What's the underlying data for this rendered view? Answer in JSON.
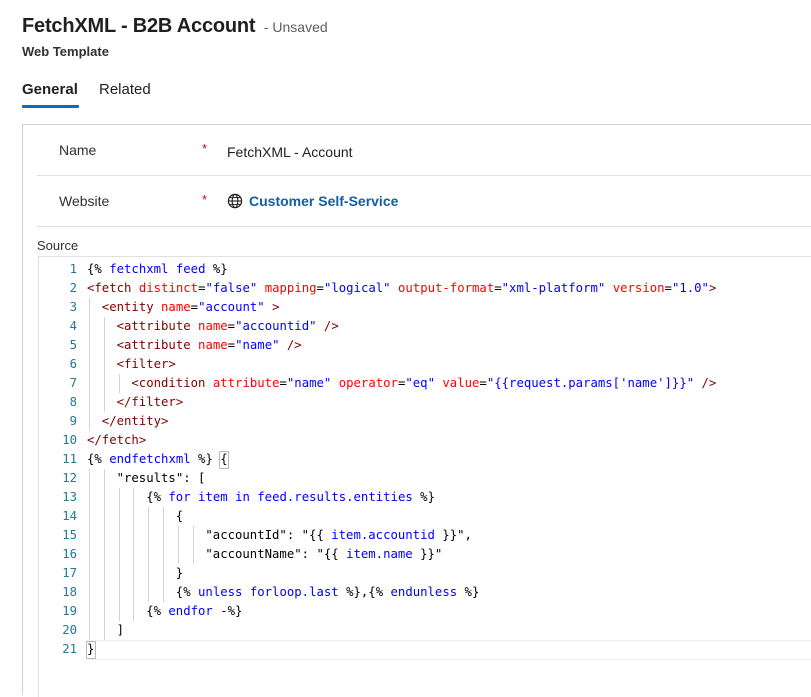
{
  "header": {
    "title": "FetchXML - B2B Account",
    "status": "- Unsaved",
    "entity_type": "Web Template"
  },
  "tabs": [
    {
      "label": "General",
      "selected": true
    },
    {
      "label": "Related",
      "selected": false
    }
  ],
  "fields": {
    "name": {
      "label": "Name",
      "required_mark": "*",
      "value": "FetchXML - Account"
    },
    "website": {
      "label": "Website",
      "required_mark": "*",
      "value": "Customer Self-Service",
      "icon": "globe-icon"
    }
  },
  "source": {
    "label": "Source",
    "lines": [
      {
        "n": "1",
        "indent": 0,
        "tokens": [
          [
            "t-plain",
            "{% "
          ],
          [
            "t-kw",
            "fetchxml"
          ],
          [
            "t-plain",
            " "
          ],
          [
            "t-kw",
            "feed"
          ],
          [
            "t-plain",
            " %}"
          ]
        ]
      },
      {
        "n": "2",
        "indent": 0,
        "tokens": [
          [
            "t-tag",
            "<fetch"
          ],
          [
            "t-plain",
            " "
          ],
          [
            "t-attr",
            "distinct"
          ],
          [
            "t-plain",
            "="
          ],
          [
            "t-val",
            "\"false\""
          ],
          [
            "t-plain",
            " "
          ],
          [
            "t-attr",
            "mapping"
          ],
          [
            "t-plain",
            "="
          ],
          [
            "t-val",
            "\"logical\""
          ],
          [
            "t-plain",
            " "
          ],
          [
            "t-attr",
            "output-format"
          ],
          [
            "t-plain",
            "="
          ],
          [
            "t-val",
            "\"xml-platform\""
          ],
          [
            "t-plain",
            " "
          ],
          [
            "t-attr",
            "version"
          ],
          [
            "t-plain",
            "="
          ],
          [
            "t-val",
            "\"1.0\""
          ],
          [
            "t-tag",
            ">"
          ]
        ]
      },
      {
        "n": "3",
        "indent": 2,
        "tokens": [
          [
            "t-tag",
            "<entity"
          ],
          [
            "t-plain",
            " "
          ],
          [
            "t-attr",
            "name"
          ],
          [
            "t-plain",
            "="
          ],
          [
            "t-val",
            "\"account\""
          ],
          [
            "t-plain",
            " "
          ],
          [
            "t-tag",
            ">"
          ]
        ]
      },
      {
        "n": "4",
        "indent": 4,
        "tokens": [
          [
            "t-tag",
            "<attribute"
          ],
          [
            "t-plain",
            " "
          ],
          [
            "t-attr",
            "name"
          ],
          [
            "t-plain",
            "="
          ],
          [
            "t-val",
            "\"accountid\""
          ],
          [
            "t-plain",
            " "
          ],
          [
            "t-tag",
            "/>"
          ]
        ]
      },
      {
        "n": "5",
        "indent": 4,
        "tokens": [
          [
            "t-tag",
            "<attribute"
          ],
          [
            "t-plain",
            " "
          ],
          [
            "t-attr",
            "name"
          ],
          [
            "t-plain",
            "="
          ],
          [
            "t-val",
            "\"name\""
          ],
          [
            "t-plain",
            " "
          ],
          [
            "t-tag",
            "/>"
          ]
        ]
      },
      {
        "n": "6",
        "indent": 4,
        "tokens": [
          [
            "t-tag",
            "<filter>"
          ]
        ]
      },
      {
        "n": "7",
        "indent": 6,
        "tokens": [
          [
            "t-tag",
            "<condition"
          ],
          [
            "t-plain",
            " "
          ],
          [
            "t-attr",
            "attribute"
          ],
          [
            "t-plain",
            "="
          ],
          [
            "t-val",
            "\"name\""
          ],
          [
            "t-plain",
            " "
          ],
          [
            "t-attr",
            "operator"
          ],
          [
            "t-plain",
            "="
          ],
          [
            "t-val",
            "\"eq\""
          ],
          [
            "t-plain",
            " "
          ],
          [
            "t-attr",
            "value"
          ],
          [
            "t-plain",
            "="
          ],
          [
            "t-val",
            "\"{{request.params['name']}}\""
          ],
          [
            "t-plain",
            " "
          ],
          [
            "t-tag",
            "/>"
          ]
        ]
      },
      {
        "n": "8",
        "indent": 4,
        "tokens": [
          [
            "t-tag",
            "</filter>"
          ]
        ]
      },
      {
        "n": "9",
        "indent": 2,
        "tokens": [
          [
            "t-tag",
            "</entity>"
          ]
        ]
      },
      {
        "n": "10",
        "indent": 0,
        "tokens": [
          [
            "t-tag",
            "</fetch>"
          ]
        ]
      },
      {
        "n": "11",
        "indent": 0,
        "tokens": [
          [
            "t-plain",
            "{% "
          ],
          [
            "t-kw",
            "endfetchxml"
          ],
          [
            "t-plain",
            " %} {"
          ]
        ]
      },
      {
        "n": "12",
        "indent": 4,
        "tokens": [
          [
            "t-plain",
            "\"results\": ["
          ]
        ]
      },
      {
        "n": "13",
        "indent": 8,
        "tokens": [
          [
            "t-plain",
            "{% "
          ],
          [
            "t-kw",
            "for"
          ],
          [
            "t-plain",
            " "
          ],
          [
            "t-kw",
            "item"
          ],
          [
            "t-plain",
            " "
          ],
          [
            "t-kw",
            "in"
          ],
          [
            "t-plain",
            " "
          ],
          [
            "t-kw",
            "feed.results.entities"
          ],
          [
            "t-plain",
            " %}"
          ]
        ]
      },
      {
        "n": "14",
        "indent": 12,
        "tokens": [
          [
            "t-plain",
            "{"
          ]
        ]
      },
      {
        "n": "15",
        "indent": 16,
        "tokens": [
          [
            "t-plain",
            "\"accountId\": \"{{ "
          ],
          [
            "t-kw",
            "item.accountid"
          ],
          [
            "t-plain",
            " }}\","
          ]
        ]
      },
      {
        "n": "16",
        "indent": 16,
        "tokens": [
          [
            "t-plain",
            "\"accountName\": \"{{ "
          ],
          [
            "t-kw",
            "item.name"
          ],
          [
            "t-plain",
            " }}\""
          ]
        ]
      },
      {
        "n": "17",
        "indent": 12,
        "tokens": [
          [
            "t-plain",
            "}"
          ]
        ]
      },
      {
        "n": "18",
        "indent": 12,
        "tokens": [
          [
            "t-plain",
            "{% "
          ],
          [
            "t-kw",
            "unless"
          ],
          [
            "t-plain",
            " "
          ],
          [
            "t-kw",
            "forloop.last"
          ],
          [
            "t-plain",
            " %},{% "
          ],
          [
            "t-kw",
            "endunless"
          ],
          [
            "t-plain",
            " %}"
          ]
        ]
      },
      {
        "n": "19",
        "indent": 8,
        "tokens": [
          [
            "t-plain",
            "{% "
          ],
          [
            "t-kw",
            "endfor"
          ],
          [
            "t-plain",
            " -%}"
          ]
        ]
      },
      {
        "n": "20",
        "indent": 4,
        "tokens": [
          [
            "t-plain",
            "]"
          ]
        ]
      },
      {
        "n": "21",
        "indent": 0,
        "tokens": [
          [
            "t-plain",
            "}"
          ]
        ]
      }
    ]
  }
}
